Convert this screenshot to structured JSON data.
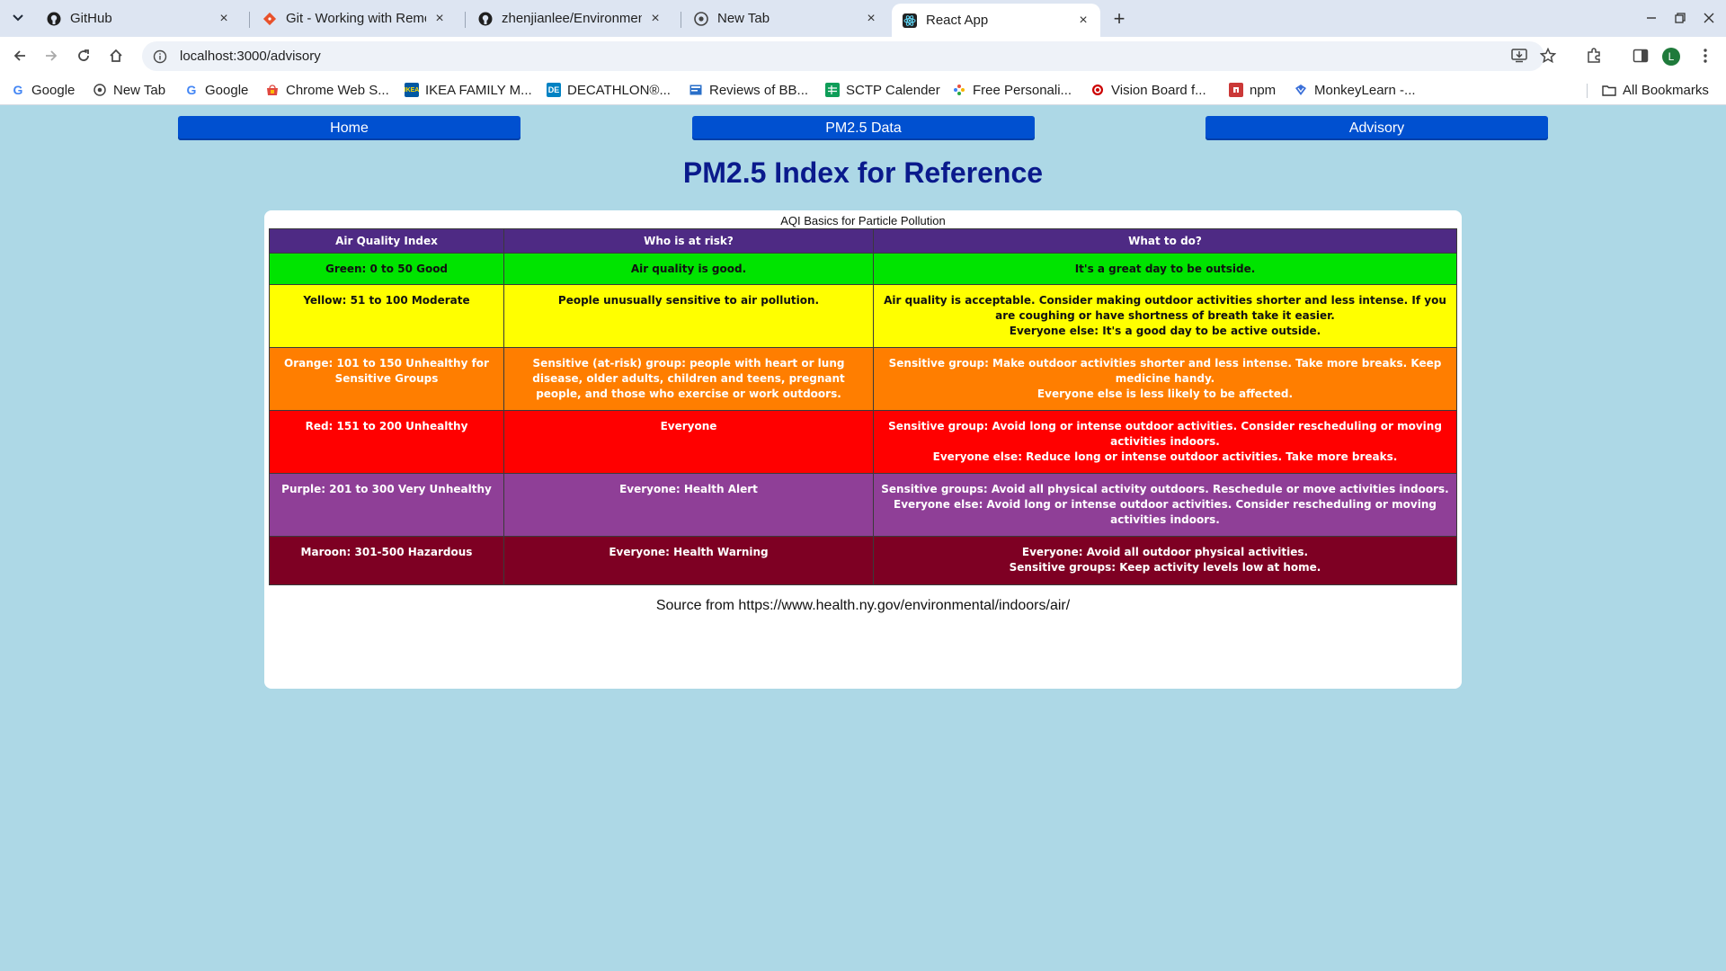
{
  "browser": {
    "tabs": [
      {
        "title": "GitHub",
        "icon": "github-icon"
      },
      {
        "title": "Git - Working with Remo",
        "icon": "git-icon"
      },
      {
        "title": "zhenjianlee/Environmen",
        "icon": "github-icon"
      },
      {
        "title": "New Tab",
        "icon": "chrome-icon"
      },
      {
        "title": "React App",
        "icon": "react-icon",
        "active": true
      }
    ],
    "url": "localhost:3000/advisory",
    "avatar_letter": "L",
    "bookmarks": [
      {
        "label": "Google"
      },
      {
        "label": "New Tab"
      },
      {
        "label": "Google"
      },
      {
        "label": "Chrome Web S..."
      },
      {
        "label": "IKEA FAMILY M..."
      },
      {
        "label": "DECATHLON®..."
      },
      {
        "label": "Reviews of BB..."
      },
      {
        "label": "SCTP Calender"
      },
      {
        "label": "Free Personali..."
      },
      {
        "label": "Vision Board f..."
      },
      {
        "label": "npm"
      },
      {
        "label": "MonkeyLearn -..."
      }
    ],
    "all_bookmarks": "All Bookmarks"
  },
  "nav": {
    "home": "Home",
    "data": "PM2.5 Data",
    "advisory": "Advisory"
  },
  "page": {
    "title": "PM2.5 Index for Reference",
    "source": "Source from https://www.health.ny.gov/environmental/indoors/air/"
  },
  "table": {
    "caption": "AQI Basics for Particle Pollution",
    "headers": [
      "Air Quality Index",
      "Who is at risk?",
      "What to do?"
    ],
    "rows": [
      {
        "aqi": "Green: 0 to 50 Good",
        "risk": "Air quality is good.",
        "todo": [
          "It's a great day to be outside."
        ]
      },
      {
        "aqi": "Yellow: 51 to 100 Moderate",
        "risk": "People unusually sensitive to air pollution.",
        "todo": [
          "Air quality is acceptable. Consider making outdoor activities shorter and less intense. If you are coughing or have shortness of breath take it easier.",
          "Everyone else: It's a good day to be active outside."
        ]
      },
      {
        "aqi": "Orange: 101 to 150 Unhealthy for Sensitive Groups",
        "risk": "Sensitive (at-risk) group: people with heart or lung disease, older adults, children and teens, pregnant people, and those who exercise or work outdoors.",
        "todo": [
          "Sensitive group: Make outdoor activities shorter and less intense. Take more breaks. Keep medicine handy.",
          "Everyone else is less likely to be affected."
        ]
      },
      {
        "aqi": "Red: 151 to 200 Unhealthy",
        "risk": "Everyone",
        "todo": [
          "Sensitive group: Avoid long or intense outdoor activities. Consider rescheduling or moving activities indoors.",
          "Everyone else: Reduce long or intense outdoor activities. Take more breaks."
        ]
      },
      {
        "aqi": "Purple: 201 to 300 Very Unhealthy",
        "risk": "Everyone: Health Alert",
        "todo": [
          "Sensitive groups: Avoid all physical activity outdoors. Reschedule or move activities indoors.",
          "Everyone else: Avoid long or intense outdoor activities. Consider rescheduling or moving activities indoors."
        ]
      },
      {
        "aqi": "Maroon: 301-500 Hazardous",
        "risk": "Everyone: Health Warning",
        "todo": [
          "Everyone: Avoid all outdoor physical activities.",
          "Sensitive groups: Keep activity levels low at home."
        ]
      }
    ]
  }
}
